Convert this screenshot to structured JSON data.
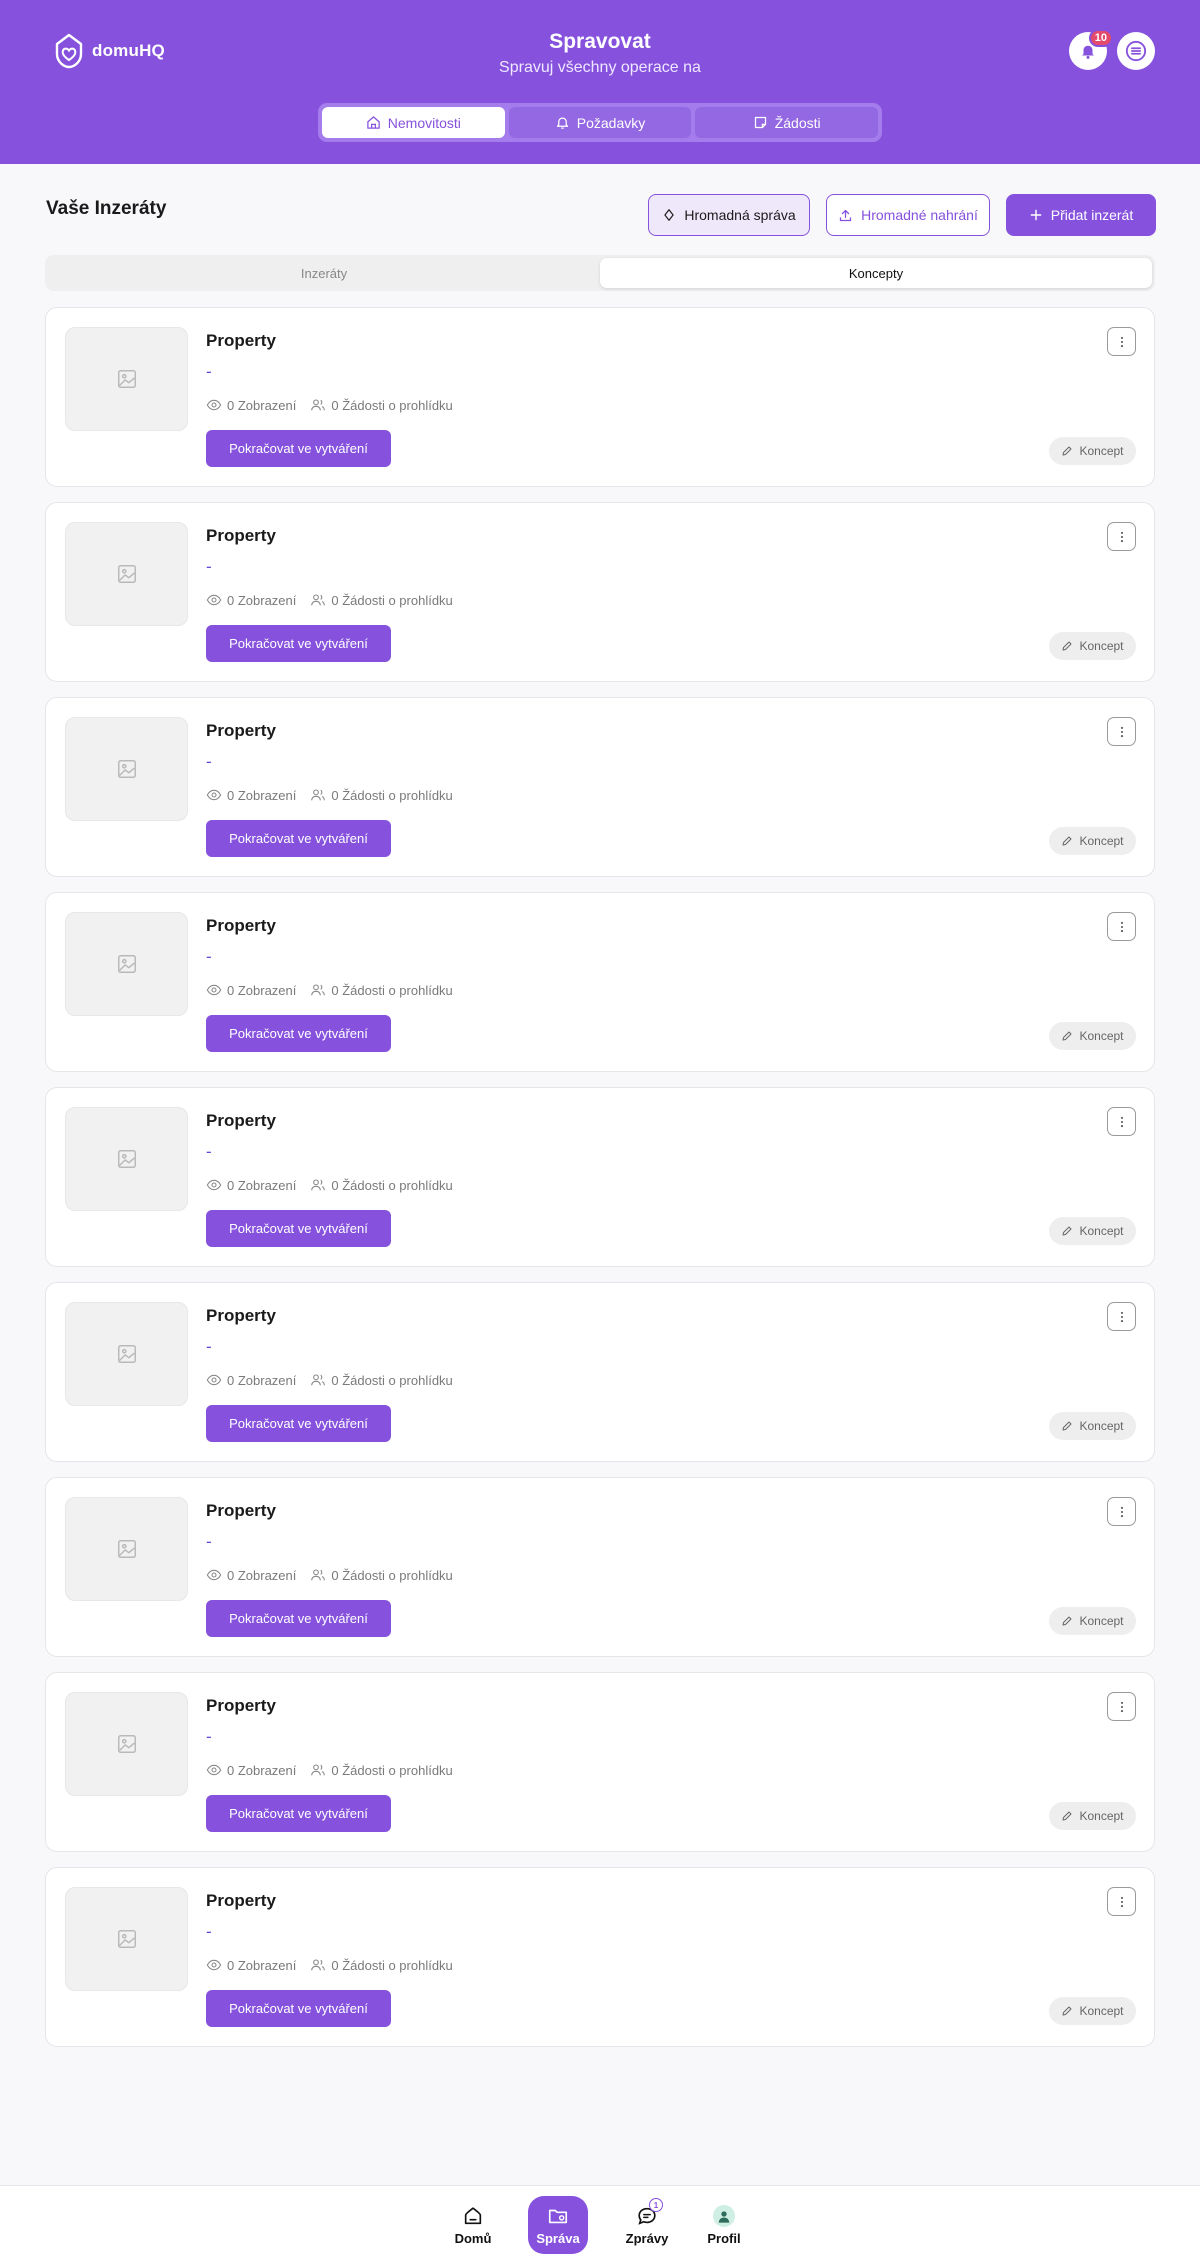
{
  "header": {
    "logo": "domuHQ",
    "title": "Spravovat",
    "subtitle": "Spravuj všechny operace na",
    "notifications_count": "10",
    "tabs": [
      {
        "label": "Nemovitosti",
        "icon": "home-icon",
        "active": true
      },
      {
        "label": "Požadavky",
        "icon": "bell-icon",
        "active": false
      },
      {
        "label": "Žádosti",
        "icon": "note-icon",
        "active": false
      }
    ]
  },
  "section": {
    "title": "Vaše Inzeráty",
    "mass_manage_label": "Hromadná správa",
    "mass_upload_label": "Hromadné nahrání",
    "add_listing_label": "Přidat inzerát",
    "tabs": [
      {
        "label": "Inzeráty",
        "active": false
      },
      {
        "label": "Koncepty",
        "active": true
      }
    ]
  },
  "listings": [
    {
      "title": "Property",
      "price": "-",
      "views": "0 Zobrazení",
      "requests": "0 Žádosti o prohlídku",
      "cta": "Pokračovat ve vytváření",
      "status": "Koncept"
    },
    {
      "title": "Property",
      "price": "-",
      "views": "0 Zobrazení",
      "requests": "0 Žádosti o prohlídku",
      "cta": "Pokračovat ve vytváření",
      "status": "Koncept"
    },
    {
      "title": "Property",
      "price": "-",
      "views": "0 Zobrazení",
      "requests": "0 Žádosti o prohlídku",
      "cta": "Pokračovat ve vytváření",
      "status": "Koncept"
    },
    {
      "title": "Property",
      "price": "-",
      "views": "0 Zobrazení",
      "requests": "0 Žádosti o prohlídku",
      "cta": "Pokračovat ve vytváření",
      "status": "Koncept"
    },
    {
      "title": "Property",
      "price": "-",
      "views": "0 Zobrazení",
      "requests": "0 Žádosti o prohlídku",
      "cta": "Pokračovat ve vytváření",
      "status": "Koncept"
    },
    {
      "title": "Property",
      "price": "-",
      "views": "0 Zobrazení",
      "requests": "0 Žádosti o prohlídku",
      "cta": "Pokračovat ve vytváření",
      "status": "Koncept"
    },
    {
      "title": "Property",
      "price": "-",
      "views": "0 Zobrazení",
      "requests": "0 Žádosti o prohlídku",
      "cta": "Pokračovat ve vytváření",
      "status": "Koncept"
    },
    {
      "title": "Property",
      "price": "-",
      "views": "0 Zobrazení",
      "requests": "0 Žádosti o prohlídku",
      "cta": "Pokračovat ve vytváření",
      "status": "Koncept"
    },
    {
      "title": "Property",
      "price": "-",
      "views": "0 Zobrazení",
      "requests": "0 Žádosti o prohlídku",
      "cta": "Pokračovat ve vytváření",
      "status": "Koncept"
    }
  ],
  "bottom_nav": {
    "home": "Domů",
    "manage": "Správa",
    "messages": "Zprávy",
    "messages_badge": "1",
    "profile": "Profil"
  },
  "colors": {
    "accent": "#8652dd",
    "badge": "#e34a6b",
    "price": "#5b4bd6"
  }
}
